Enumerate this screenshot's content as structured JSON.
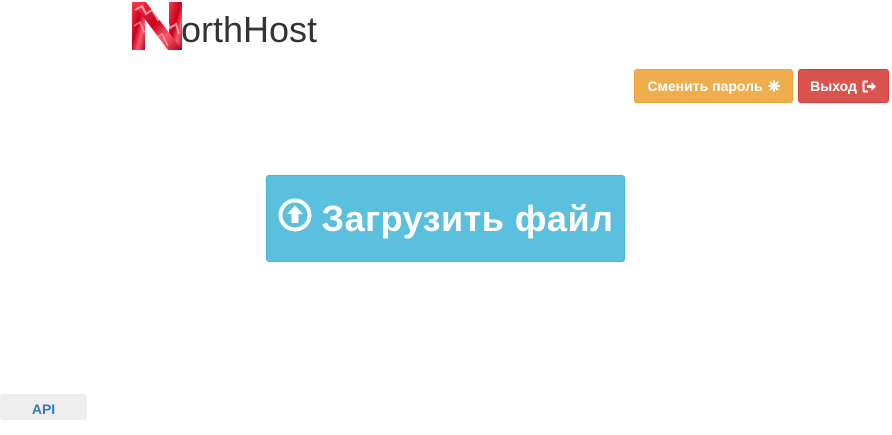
{
  "logo": {
    "letter_icon": "n-logo-mark",
    "text": "orthHost"
  },
  "actions": {
    "change_password_label": "Сменить пароль",
    "change_password_icon": "asterisk-icon",
    "logout_label": "Выход",
    "logout_icon": "logout-icon"
  },
  "upload": {
    "label": "Загрузить файл",
    "icon": "circle-arrow-up-icon"
  },
  "footer": {
    "api_label": "API"
  },
  "colors": {
    "warning": "#f0ad4e",
    "danger": "#d9534f",
    "info": "#5bc0de",
    "link": "#337ab7",
    "logo_red": "#c8001e"
  }
}
